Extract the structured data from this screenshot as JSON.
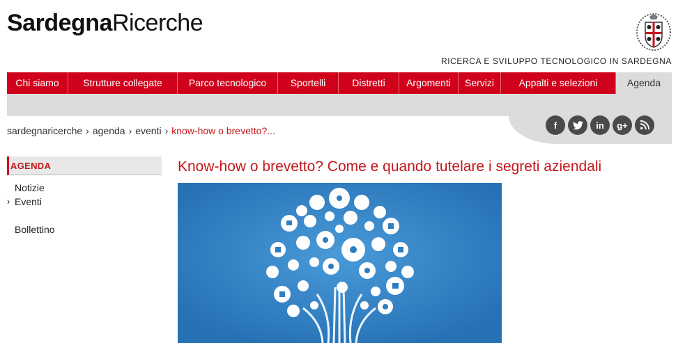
{
  "header": {
    "logo_bold": "Sardegna",
    "logo_light": "Ricerche",
    "tagline": "RICERCA E SVILUPPO TECNOLOGICO IN SARDEGNA",
    "crest_icon": "sardinia-crest-icon"
  },
  "nav": {
    "items": [
      {
        "label": "Chi siamo"
      },
      {
        "label": "Strutture collegate"
      },
      {
        "label": "Parco tecnologico"
      },
      {
        "label": "Sportelli"
      },
      {
        "label": "Distretti"
      },
      {
        "label": "Argomenti"
      },
      {
        "label": "Servizi"
      },
      {
        "label": "Appalti e selezioni"
      },
      {
        "label": "Agenda",
        "active": true
      }
    ]
  },
  "social": [
    {
      "icon": "facebook-icon",
      "glyph": "f"
    },
    {
      "icon": "twitter-icon",
      "glyph": "t"
    },
    {
      "icon": "linkedin-icon",
      "glyph": "in"
    },
    {
      "icon": "googleplus-icon",
      "glyph": "g+"
    },
    {
      "icon": "rss-icon",
      "glyph": "⌔"
    }
  ],
  "breadcrumb": {
    "items": [
      "sardegnaricerche",
      "agenda",
      "eventi"
    ],
    "current": "know-how o brevetto?...",
    "separator": "›"
  },
  "sidebar": {
    "heading": "AGENDA",
    "items": [
      {
        "label": "Notizie"
      },
      {
        "label": "Eventi",
        "current": true,
        "caret": "›"
      },
      {
        "label": "Bollettino"
      }
    ]
  },
  "article": {
    "title": "Know-how o brevetto? Come e quando tutelare i segreti aziendali",
    "image_icon": "social-tree-illustration"
  },
  "colors": {
    "brand_red": "#d0021b",
    "link_red": "#c4161c",
    "nav_gray": "#dcdcdc",
    "image_blue": "#2c7ec0",
    "social_dark": "#4a4a4a"
  }
}
